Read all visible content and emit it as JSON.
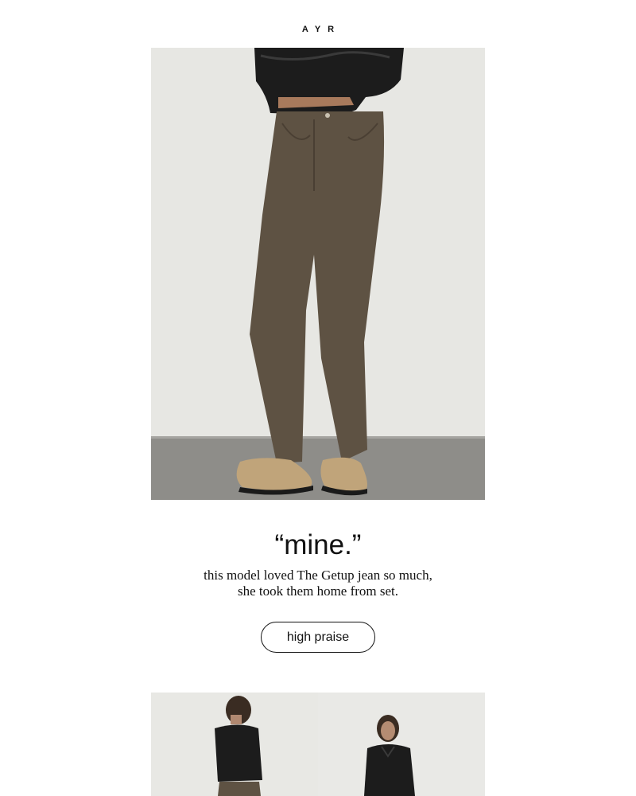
{
  "brand": {
    "logo_text": "AYR"
  },
  "hero": {
    "alt": "model wearing brown The Getup jeans, black leather jacket and tan suede clogs"
  },
  "headline": "“mine.”",
  "subline": {
    "line1": "this model loved The Getup jean so much,",
    "line2": "she took them home from set."
  },
  "cta": {
    "label": "high praise"
  },
  "colors": {
    "background": "#ffffff",
    "photo_wall": "#e7e7e3",
    "photo_floor": "#8d8c88",
    "denim": "#5e5243",
    "leather": "#1d1d1d",
    "suede": "#c0a47a",
    "text": "#111111"
  }
}
